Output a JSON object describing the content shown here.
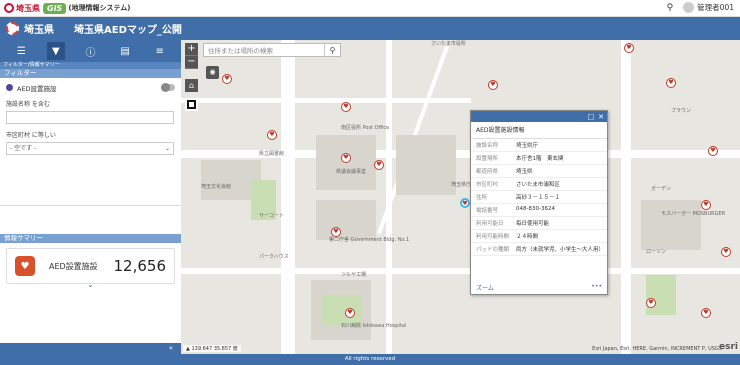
{
  "topbar": {
    "pref_name": "埼玉県",
    "gis_label": "GIS",
    "system_label": "(地理情報システム)",
    "user_name": "管理者001"
  },
  "header": {
    "pref_name": "埼玉県",
    "title": "埼玉県AEDマップ_公開"
  },
  "left": {
    "subtitle": "フィルター/情報サマリー",
    "filter_section": "フィルター",
    "filter_layer": "AED設置施設",
    "field1_label": "施設名称 を含む",
    "field1_value": "",
    "field2_label": "市区町村 に等しい",
    "field2_value": "- 空です -",
    "summary_section": "情報サマリー",
    "summary_name": "AED設置施設",
    "summary_count": "12,656",
    "collapse_label": "«"
  },
  "map": {
    "search_placeholder": "住所または場所の検索",
    "labels": [
      "さいたま市役所",
      "南区役所 Post Office",
      "県立図書館",
      "県議会議事堂",
      "埼玉県庁 Saitama Pref.",
      "第二庁舎 Government Bldg. No.1",
      "サーコート",
      "パークハウス",
      "ツルヤ工場",
      "石川病院 Ishikawa Hospital",
      "埼玉文化会館",
      "モスバーガー MOSBURGER",
      "ローソン",
      "ブラウン",
      "ガーデン"
    ],
    "coords": "139.647 35.857 度",
    "attribution": "Esri Japan, Esri, HERE, Garmin, INCREMENT P, USGS",
    "esri_logo": "esri"
  },
  "popup": {
    "title": "AED設置施設情報",
    "rows": [
      {
        "key": "施設名称",
        "val": "埼玉県庁"
      },
      {
        "key": "設置場所",
        "val": "本庁舎1階　東玄関"
      },
      {
        "key": "都道府県",
        "val": "埼玉県"
      },
      {
        "key": "市区町村",
        "val": "さいたま市浦和区"
      },
      {
        "key": "住所",
        "val": "高砂３－１５－１"
      },
      {
        "key": "電話番号",
        "val": "048-830-3624"
      },
      {
        "key": "利用可能日",
        "val": "毎日使用可能"
      },
      {
        "key": "利用可能時間",
        "val": "２４時間"
      },
      {
        "key": "パッドの種類",
        "val": "両方（未就学児、小学生～大人用）"
      }
    ],
    "zoom_label": "ズーム",
    "more_label": "•••"
  },
  "footer": {
    "text": "All rights reserved"
  }
}
